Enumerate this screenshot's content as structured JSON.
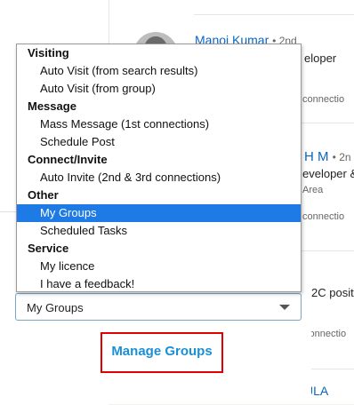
{
  "background": {
    "profile_1": {
      "name": "Manoj Kumar",
      "degree": "• 2nd",
      "headline": "eloper",
      "meta": "connectio"
    },
    "profile_2": {
      "name": "H M",
      "degree": "• 2n",
      "headline": "eveloper &",
      "location": "Area",
      "meta": "connectio"
    },
    "profile_3": {
      "headline": "2C posit",
      "meta": "connectio"
    },
    "profile_4": {
      "name": "ULA"
    }
  },
  "dropdown": {
    "groups": [
      {
        "label": "Visiting",
        "options": [
          "Auto Visit (from search results)",
          "Auto Visit (from group)"
        ]
      },
      {
        "label": "Message",
        "options": [
          "Mass Message (1st connections)",
          "Schedule Post"
        ]
      },
      {
        "label": "Connect/Invite",
        "options": [
          "Auto Invite (2nd & 3rd connections)"
        ]
      },
      {
        "label": "Other",
        "options": [
          "My Groups",
          "Scheduled Tasks"
        ]
      },
      {
        "label": "Service",
        "options": [
          "My licence",
          "I have a feedback!"
        ]
      }
    ],
    "selected": "My Groups"
  },
  "select": {
    "value": "My Groups"
  },
  "manage_groups": {
    "label": "Manage Groups"
  },
  "colors": {
    "accent": "#1a8fd6",
    "highlight": "#1e7be6",
    "border_highlight": "#e10000",
    "link": "#0a66c2"
  }
}
